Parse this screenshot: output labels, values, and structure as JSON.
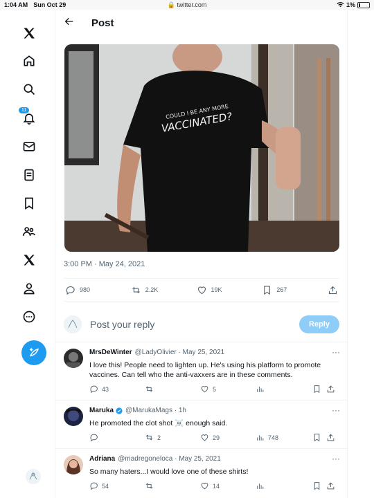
{
  "status_bar": {
    "time": "1:04 AM",
    "date": "Sun Oct 29",
    "url": "twitter.com",
    "battery": "1%"
  },
  "sidebar": {
    "notification_count": "11"
  },
  "header": {
    "title": "Post"
  },
  "tweet": {
    "shirt_text": "COULD I BE ANY MORE VACCINATED?",
    "timestamp": "3:00 PM · May 24, 2021",
    "stats": {
      "replies": "980",
      "reposts": "2.2K",
      "likes": "19K",
      "bookmarks": "267"
    }
  },
  "reply": {
    "placeholder": "Post your reply",
    "button_label": "Reply"
  },
  "comments": [
    {
      "name": "MrsDeWinter",
      "handle": "@LadyOlivier · May 25, 2021",
      "text": "I love this!  People need to lighten up. He's using his platform to promote vaccines. Can tell who the anti-vaxxers are in these comments.",
      "replies": "43",
      "reposts": "",
      "likes": "5",
      "views": ""
    },
    {
      "name": "Maruka",
      "handle": "@MarukaMags · 1h",
      "text": "He promoted the clot shot ☠️ enough said.",
      "replies": "",
      "reposts": "2",
      "likes": "29",
      "views": "748"
    },
    {
      "name": "Adriana",
      "handle": "@madregoneloca · May 25, 2021",
      "text": "So many haters...I would love one of these shirts!",
      "replies": "54",
      "reposts": "",
      "likes": "14",
      "views": ""
    }
  ],
  "colors": {
    "accent": "#1d9bf0",
    "reply_disabled": "#8ecdf7",
    "muted": "#536471"
  }
}
